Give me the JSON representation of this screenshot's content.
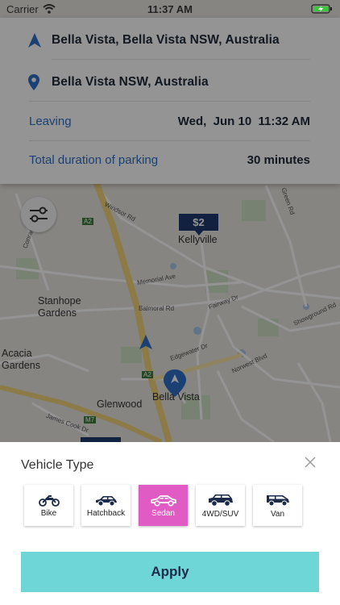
{
  "status_bar": {
    "carrier": "Carrier",
    "time": "11:37 AM"
  },
  "trip": {
    "origin": "Bella Vista, Bella Vista NSW, Australia",
    "destination": "Bella Vista NSW, Australia",
    "leaving_label": "Leaving",
    "leaving_value": "Wed,  Jun 10  11:32 AM",
    "duration_label": "Total duration of parking",
    "duration_value": "30 minutes"
  },
  "map": {
    "price_tag": "$2",
    "places": [
      "Kellyville",
      "Stanhope\nGardens",
      "Acacia\nGardens",
      "Glenwood",
      "Bella Vista"
    ],
    "roads": [
      "Windsor Rd",
      "Memorial Ave",
      "Balmoral Rd",
      "Fairway Dr",
      "Edgewater Dr",
      "Norwest Blvd",
      "Showground Rd",
      "Green Rd",
      "Conrad Rd",
      "James Cook Dr",
      "A2",
      "A2",
      "M7"
    ]
  },
  "vehicle_sheet": {
    "title": "Vehicle Type",
    "options": [
      {
        "label": "Bike",
        "icon": "motorbike-icon",
        "selected": false
      },
      {
        "label": "Hatchback",
        "icon": "hatchback-icon",
        "selected": false
      },
      {
        "label": "Sedan",
        "icon": "sedan-icon",
        "selected": true
      },
      {
        "label": "4WD/SUV",
        "icon": "suv-icon",
        "selected": false
      },
      {
        "label": "Van",
        "icon": "van-icon",
        "selected": false
      }
    ],
    "apply_label": "Apply"
  },
  "colors": {
    "accent_blue": "#2f6ec9",
    "selected_pink": "#e05cc4",
    "apply_teal": "#6ed6d6",
    "price_navy": "#1f3a6e"
  }
}
